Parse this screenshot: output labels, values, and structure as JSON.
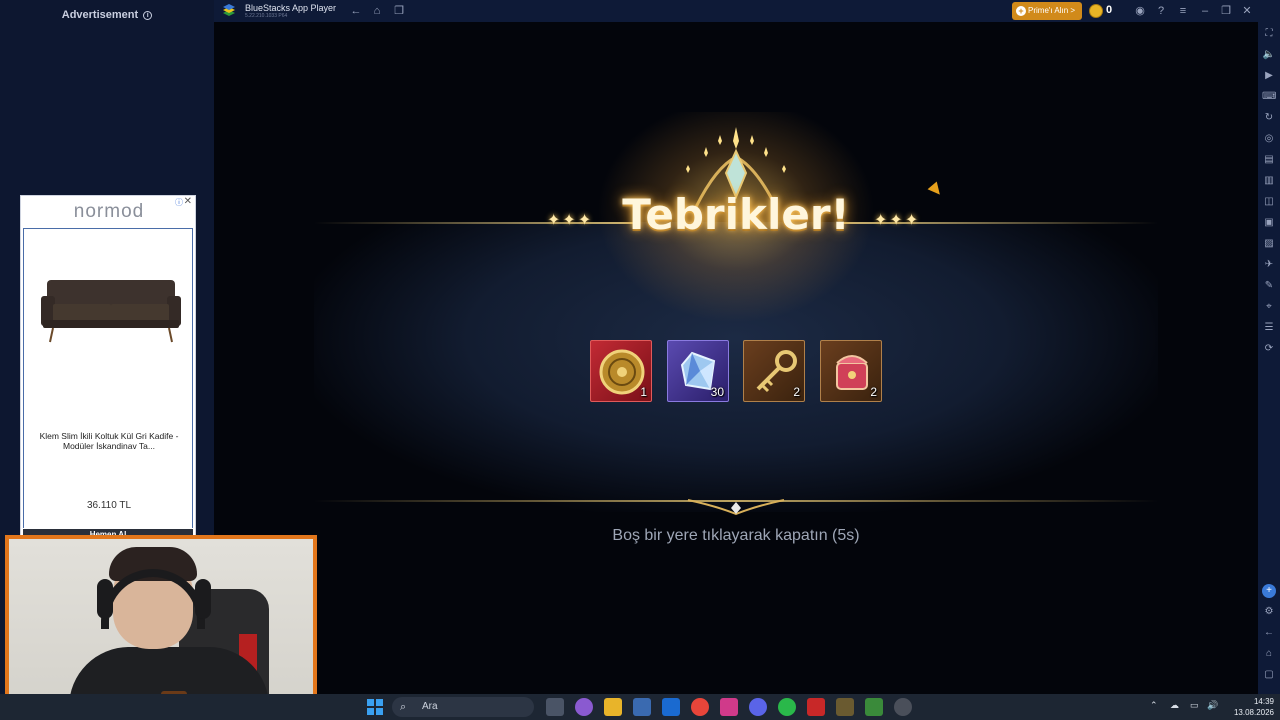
{
  "window": {
    "app_title": "BlueStacks App Player",
    "app_version": "5.22.210.1033 P64",
    "prime_button": "Prime'ı Alın >",
    "coin_count": "0"
  },
  "ad": {
    "header": "Advertisement",
    "brand": "normod",
    "product_description": "Klem Slim İkili Koltuk Kül Gri Kadife - Modüler İskandinav Ta...",
    "price": "36.110 TL",
    "cta": "Hemen Al"
  },
  "game": {
    "title": "Tebrikler!",
    "rewards": [
      {
        "name": "gold-medallion",
        "count": "1",
        "frame_color": "#b3202a"
      },
      {
        "name": "blue-crystal",
        "count": "30",
        "frame_color": "#4a3a9a"
      },
      {
        "name": "golden-key",
        "count": "2",
        "frame_color": "#7a4a22"
      },
      {
        "name": "red-chest",
        "count": "2",
        "frame_color": "#7a4a22"
      }
    ],
    "close_hint": "Boş bir yere tıklayarak kapatın (5s)"
  },
  "taskbar": {
    "search_placeholder": "Ara",
    "time": "14:39",
    "date": "13.08.2026"
  },
  "colors": {
    "accent_orange": "#e2761b",
    "gold": "#e8b84a",
    "bluestacks_bg": "#0e1a37"
  }
}
